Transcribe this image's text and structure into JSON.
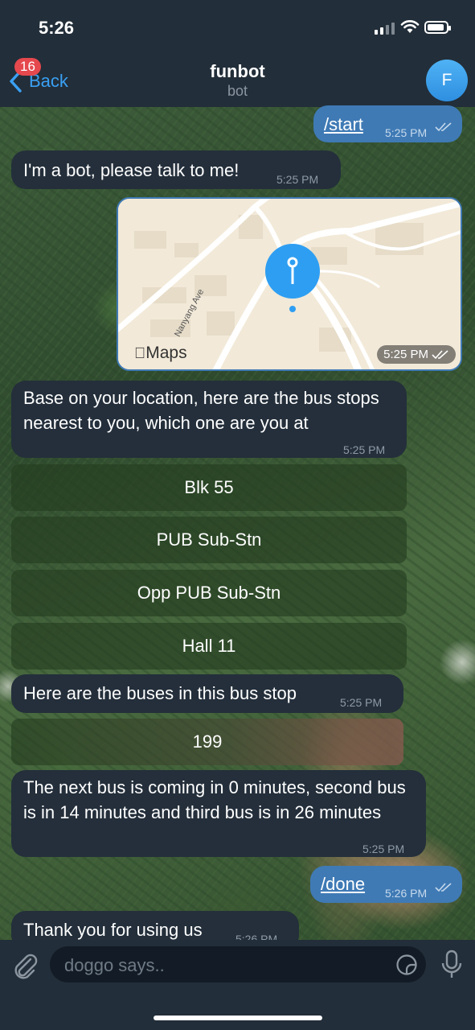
{
  "status_bar": {
    "time": "5:26"
  },
  "header": {
    "back_label": "Back",
    "unread_badge": "16",
    "title": "funbot",
    "subtitle": "bot",
    "avatar_letter": "F"
  },
  "messages": {
    "start": {
      "text": "/start",
      "time": "5:25 PM"
    },
    "bot_intro": {
      "text": "I'm a bot, please talk to me!",
      "time": "5:25 PM"
    },
    "location": {
      "map_label": "Maps",
      "road_label": "Nanyang Ave",
      "time": "5:25 PM"
    },
    "bus_stop_prompt": {
      "text": "Base on your location, here are the bus stops nearest to you, which one are you at",
      "time": "5:25 PM"
    },
    "bus_stop_buttons": [
      "Blk 55",
      "PUB Sub-Stn",
      "Opp PUB Sub-Stn",
      "Hall 11"
    ],
    "buses_prompt": {
      "text": "Here are the buses in this bus stop",
      "time": "5:25 PM"
    },
    "bus_buttons": [
      "199"
    ],
    "arrival": {
      "text": "The next bus is coming in 0 minutes, second bus is in 14 minutes and third bus is in 26 minutes",
      "time": "5:25 PM"
    },
    "done": {
      "text": "/done",
      "time": "5:26 PM"
    },
    "thanks": {
      "text": "Thank you for using us",
      "time": "5:26 PM"
    }
  },
  "input": {
    "placeholder": "doggo says.."
  },
  "colors": {
    "accent": "#3aa0f3",
    "incoming_bubble": "#242f3b",
    "outgoing_bubble": "#3f7ab5",
    "badge": "#e5484d"
  }
}
